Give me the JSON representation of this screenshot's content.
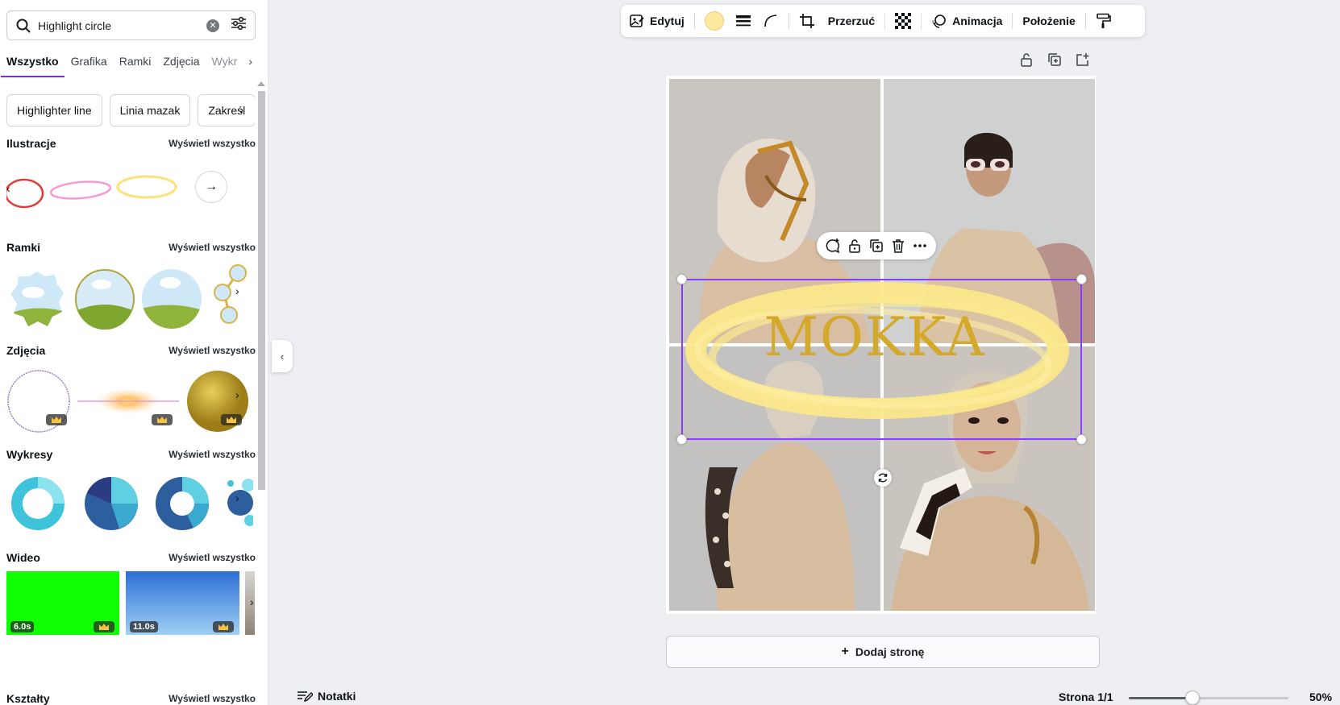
{
  "search": {
    "value": "Highlight circle"
  },
  "tabs": [
    {
      "label": "Wszystko"
    },
    {
      "label": "Grafika"
    },
    {
      "label": "Ramki"
    },
    {
      "label": "Zdjęcia"
    },
    {
      "label": "Wykr"
    }
  ],
  "chips": [
    {
      "label": "Highlighter line"
    },
    {
      "label": "Linia mazak"
    },
    {
      "label": "Zakreśl"
    }
  ],
  "view_all": "Wyświetl wszystko",
  "sections": {
    "illustrations": "Ilustracje",
    "frames": "Ramki",
    "photos": "Zdjęcia",
    "charts": "Wykresy",
    "video": "Wideo",
    "shapes": "Kształty"
  },
  "videos": [
    {
      "duration": "6.0s"
    },
    {
      "duration": "11.0s"
    }
  ],
  "toolbar": {
    "edit": "Edytuj",
    "flip": "Przerzuć",
    "animation": "Animacja",
    "position": "Położenie",
    "color": "#fde9a0"
  },
  "canvas": {
    "text": "MOKKA",
    "text_color": "#d4a92a",
    "highlight_color": "#fbe78a"
  },
  "add_page": "Dodaj stronę",
  "footer": {
    "notes": "Notatki",
    "page": "Strona 1/1",
    "zoom": "50%",
    "zoom_fraction": 0.4
  },
  "accent": "#7d2ae8"
}
